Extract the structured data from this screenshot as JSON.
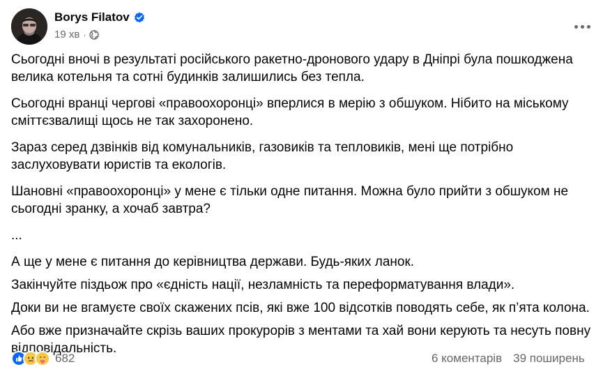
{
  "author": {
    "name": "Borys Filatov",
    "verified": true
  },
  "meta": {
    "time": "19 хв",
    "separator": "·",
    "audience_icon": "globe-icon"
  },
  "paragraphs": [
    "Сьогодні вночі в результаті російського ракетно-дронового удару в Дніпрі була пошкоджена велика котельня та сотні будинків залишились без тепла.",
    "Сьогодні вранці чергові «правоохоронці» вперлися в мерію з обшуком. Нібито на міському сміттєзвалищі щось не так захоронено.",
    "Зараз серед дзвінків від комунальників, газовиків та тепловиків, мені ще потрібно заслуховувати юристів та екологів.",
    "Шановні «правоохоронці» у мене є тільки одне питання. Можна було прийти з обшуком не сьогодні зранку, а хочаб завтра?",
    "...",
    "А ще у мене є питання до керівництва держави. Будь-яких ланок.",
    "Закінчуйте піздьож про «єдність нації, незламність та переформатування влади».",
    "Доки ви не вгамуєте своїх скажених псів, які вже 100 відсотків поводять себе, як п’ята колона.",
    "Або вже призначайте скрізь ваших прокурорів з ментами та хай вони керують та несуть повну відповідальність."
  ],
  "reactions": {
    "icons": [
      "like-icon",
      "sad-icon",
      "care-icon"
    ],
    "count": "682"
  },
  "stats": {
    "comments": "6 коментарів",
    "shares": "39 поширень"
  },
  "colors": {
    "verified": "#0866ff",
    "secondary_text": "#65676b",
    "like": "#0866ff",
    "emoji": "#f7c74a"
  }
}
